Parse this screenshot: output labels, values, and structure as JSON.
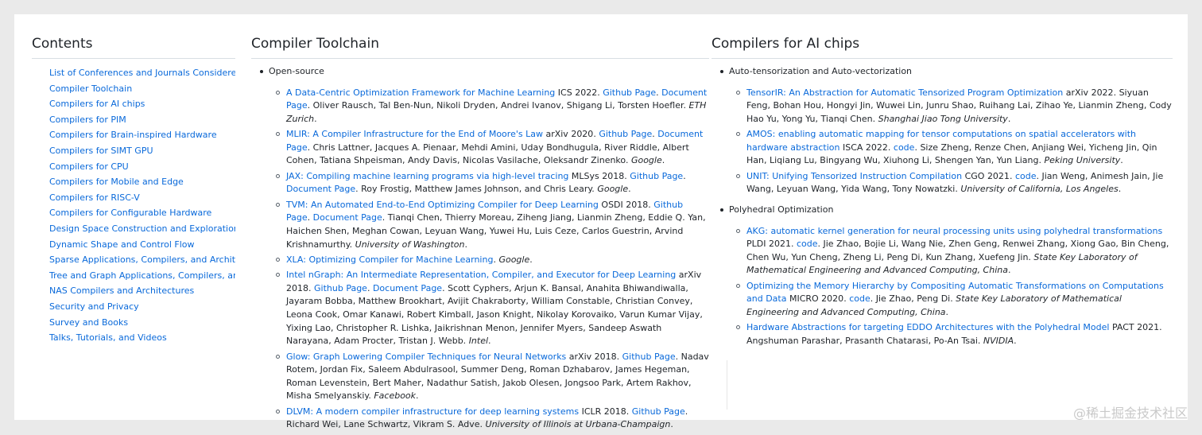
{
  "contents": {
    "title": "Contents",
    "items": [
      "List of Conferences and Journals Considered",
      "Compiler Toolchain",
      "Compilers for AI chips",
      "Compilers for PIM",
      "Compilers for Brain-inspired Hardware",
      "Compilers for SIMT GPU",
      "Compilers for CPU",
      "Compilers for Mobile and Edge",
      "Compilers for RISC-V",
      "Compilers for Configurable Hardware",
      "Design Space Construction and Exploration",
      "Dynamic Shape and Control Flow",
      "Sparse Applications, Compilers, and Architectures",
      "Tree and Graph Applications, Compilers, and Architectures",
      "NAS Compilers and Architectures",
      "Security and Privacy",
      "Survey and Books",
      "Talks, Tutorials, and Videos"
    ]
  },
  "toolchain": {
    "title": "Compiler Toolchain",
    "group": "Open-source",
    "entries": [
      {
        "title": "A Data-Centric Optimization Framework for Machine Learning",
        "venue": "ICS 2022",
        "links": [
          "Github Page",
          "Document Page"
        ],
        "authors": "Oliver Rausch, Tal Ben-Nun, Nikoli Dryden, Andrei Ivanov, Shigang Li, Torsten Hoefler.",
        "inst": "ETH Zurich"
      },
      {
        "title": "MLIR: A Compiler Infrastructure for the End of Moore's Law",
        "venue": "arXiv 2020",
        "links": [
          "Github Page",
          "Document Page"
        ],
        "authors": "Chris Lattner, Jacques A. Pienaar, Mehdi Amini, Uday Bondhugula, River Riddle, Albert Cohen, Tatiana Shpeisman, Andy Davis, Nicolas Vasilache, Oleksandr Zinenko.",
        "inst": "Google"
      },
      {
        "title": "JAX: Compiling machine learning programs via high-level tracing",
        "venue": "MLSys 2018",
        "links": [
          "Github Page",
          "Document Page"
        ],
        "authors": "Roy Frostig, Matthew James Johnson, and Chris Leary.",
        "inst": "Google"
      },
      {
        "title": "TVM: An Automated End-to-End Optimizing Compiler for Deep Learning",
        "venue": "OSDI 2018",
        "links": [
          "Github Page",
          "Document Page"
        ],
        "authors": "Tianqi Chen, Thierry Moreau, Ziheng Jiang, Lianmin Zheng, Eddie Q. Yan, Haichen Shen, Meghan Cowan, Leyuan Wang, Yuwei Hu, Luis Ceze, Carlos Guestrin, Arvind Krishnamurthy.",
        "inst": "University of Washington"
      },
      {
        "title": "XLA: Optimizing Compiler for Machine Learning",
        "venue": "",
        "links": [],
        "authors": "",
        "inst": "Google"
      },
      {
        "title": "Intel nGraph: An Intermediate Representation, Compiler, and Executor for Deep Learning",
        "venue": "arXiv 2018",
        "links": [
          "Github Page",
          "Document Page"
        ],
        "authors": "Scott Cyphers, Arjun K. Bansal, Anahita Bhiwandiwalla, Jayaram Bobba, Matthew Brookhart, Avijit Chakraborty, William Constable, Christian Convey, Leona Cook, Omar Kanawi, Robert Kimball, Jason Knight, Nikolay Korovaiko, Varun Kumar Vijay, Yixing Lao, Christopher R. Lishka, Jaikrishnan Menon, Jennifer Myers, Sandeep Aswath Narayana, Adam Procter, Tristan J. Webb.",
        "inst": "Intel"
      },
      {
        "title": "Glow: Graph Lowering Compiler Techniques for Neural Networks",
        "venue": "arXiv 2018",
        "links": [
          "Github Page"
        ],
        "authors": "Nadav Rotem, Jordan Fix, Saleem Abdulrasool, Summer Deng, Roman Dzhabarov, James Hegeman, Roman Levenstein, Bert Maher, Nadathur Satish, Jakob Olesen, Jongsoo Park, Artem Rakhov, Misha Smelyanskiy.",
        "inst": "Facebook"
      },
      {
        "title": "DLVM: A modern compiler infrastructure for deep learning systems",
        "venue": "ICLR 2018",
        "links": [
          "Github Page"
        ],
        "authors": "Richard Wei, Lane Schwartz, Vikram S. Adve.",
        "inst": "University of Illinois at Urbana-Champaign"
      }
    ]
  },
  "ai_chips": {
    "title": "Compilers for AI chips",
    "groups": [
      {
        "name": "Auto-tensorization and Auto-vectorization",
        "entries": [
          {
            "title": "TensorIR: An Abstraction for Automatic Tensorized Program Optimization",
            "venue": "arXiv 2022",
            "links": [],
            "authors": "Siyuan Feng, Bohan Hou, Hongyi Jin, Wuwei Lin, Junru Shao, Ruihang Lai, Zihao Ye, Lianmin Zheng, Cody Hao Yu, Yong Yu, Tianqi Chen.",
            "inst": "Shanghai Jiao Tong University"
          },
          {
            "title": "AMOS: enabling automatic mapping for tensor computations on spatial accelerators with hardware abstraction",
            "venue": "ISCA 2022",
            "links": [
              "code"
            ],
            "authors": "Size Zheng, Renze Chen, Anjiang Wei, Yicheng Jin, Qin Han, Liqiang Lu, Bingyang Wu, Xiuhong Li, Shengen Yan, Yun Liang.",
            "inst": "Peking University"
          },
          {
            "title": "UNIT: Unifying Tensorized Instruction Compilation",
            "venue": "CGO 2021",
            "links": [
              "code"
            ],
            "authors": "Jian Weng, Animesh Jain, Jie Wang, Leyuan Wang, Yida Wang, Tony Nowatzki.",
            "inst": "University of California, Los Angeles"
          }
        ]
      },
      {
        "name": "Polyhedral Optimization",
        "entries": [
          {
            "title": "AKG: automatic kernel generation for neural processing units using polyhedral transformations",
            "venue": "PLDI 2021",
            "links": [
              "code"
            ],
            "authors": "Jie Zhao, Bojie Li, Wang Nie, Zhen Geng, Renwei Zhang, Xiong Gao, Bin Cheng, Chen Wu, Yun Cheng, Zheng Li, Peng Di, Kun Zhang, Xuefeng Jin.",
            "inst": "State Key Laboratory of Mathematical Engineering and Advanced Computing, China"
          },
          {
            "title": "Optimizing the Memory Hierarchy by Compositing Automatic Transformations on Computations and Data",
            "venue": "MICRO 2020",
            "links": [
              "code"
            ],
            "authors": "Jie Zhao, Peng Di.",
            "inst": "State Key Laboratory of Mathematical Engineering and Advanced Computing, China"
          },
          {
            "title": "Hardware Abstractions for targeting EDDO Architectures with the Polyhedral Model",
            "venue": "PACT 2021",
            "links": [],
            "authors": "Angshuman Parashar, Prasanth Chatarasi, Po-An Tsai.",
            "inst": "NVIDIA"
          }
        ]
      }
    ]
  },
  "watermark": "@稀土掘金技术社区"
}
